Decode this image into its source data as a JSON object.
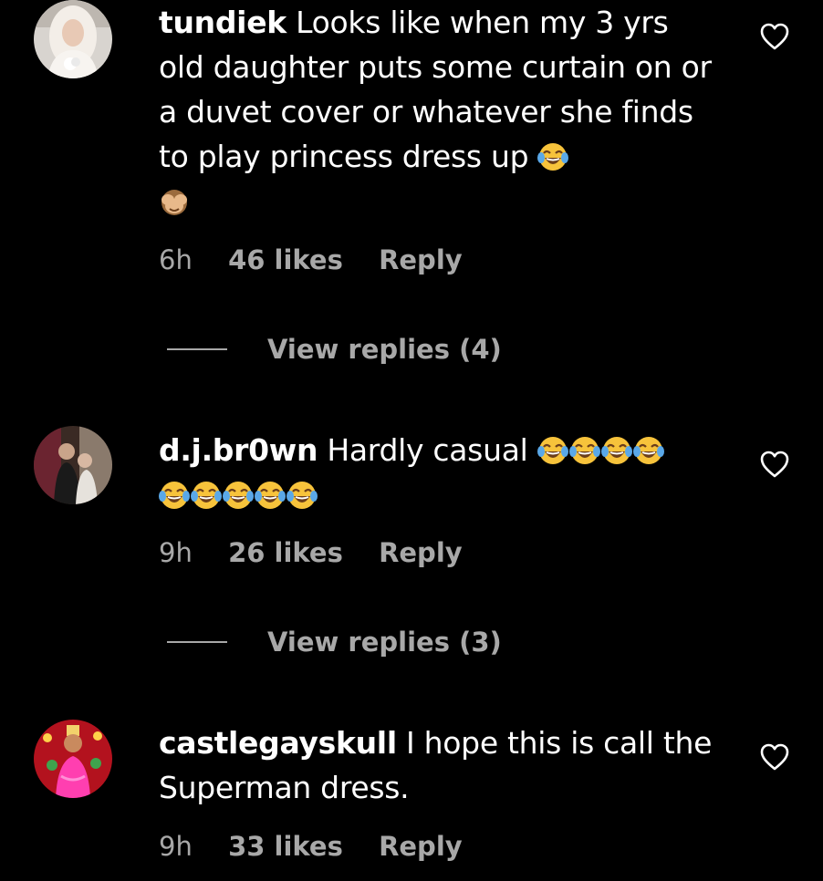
{
  "comments": [
    {
      "username": "tundiek",
      "text": "Looks like when my 3 yrs old daughter puts some curtain on or a duvet cover or whatever she finds to play princess dress up",
      "emojis_inline": [
        "face-with-tears-of-joy"
      ],
      "emojis_after": [
        "see-no-evil-monkey"
      ],
      "time": "6h",
      "likes": "46 likes",
      "reply": "Reply",
      "view_replies": "View replies (4)"
    },
    {
      "username": "d.j.br0wn",
      "text": "Hardly casual",
      "emojis_inline": [
        "face-with-tears-of-joy",
        "face-with-tears-of-joy",
        "face-with-tears-of-joy",
        "face-with-tears-of-joy"
      ],
      "emojis_after": [
        "face-with-tears-of-joy",
        "face-with-tears-of-joy",
        "face-with-tears-of-joy",
        "face-with-tears-of-joy",
        "face-with-tears-of-joy"
      ],
      "time": "9h",
      "likes": "26 likes",
      "reply": "Reply",
      "view_replies": "View replies (3)"
    },
    {
      "username": "castlegayskull",
      "text": "I hope this is call the Superman dress.",
      "time": "9h",
      "likes": "33 likes",
      "reply": "Reply"
    }
  ],
  "icons": {
    "like": "heart-outline-icon"
  },
  "colors": {
    "background": "#000000",
    "primary_text": "#ffffff",
    "secondary_text": "#a8a8a8"
  }
}
